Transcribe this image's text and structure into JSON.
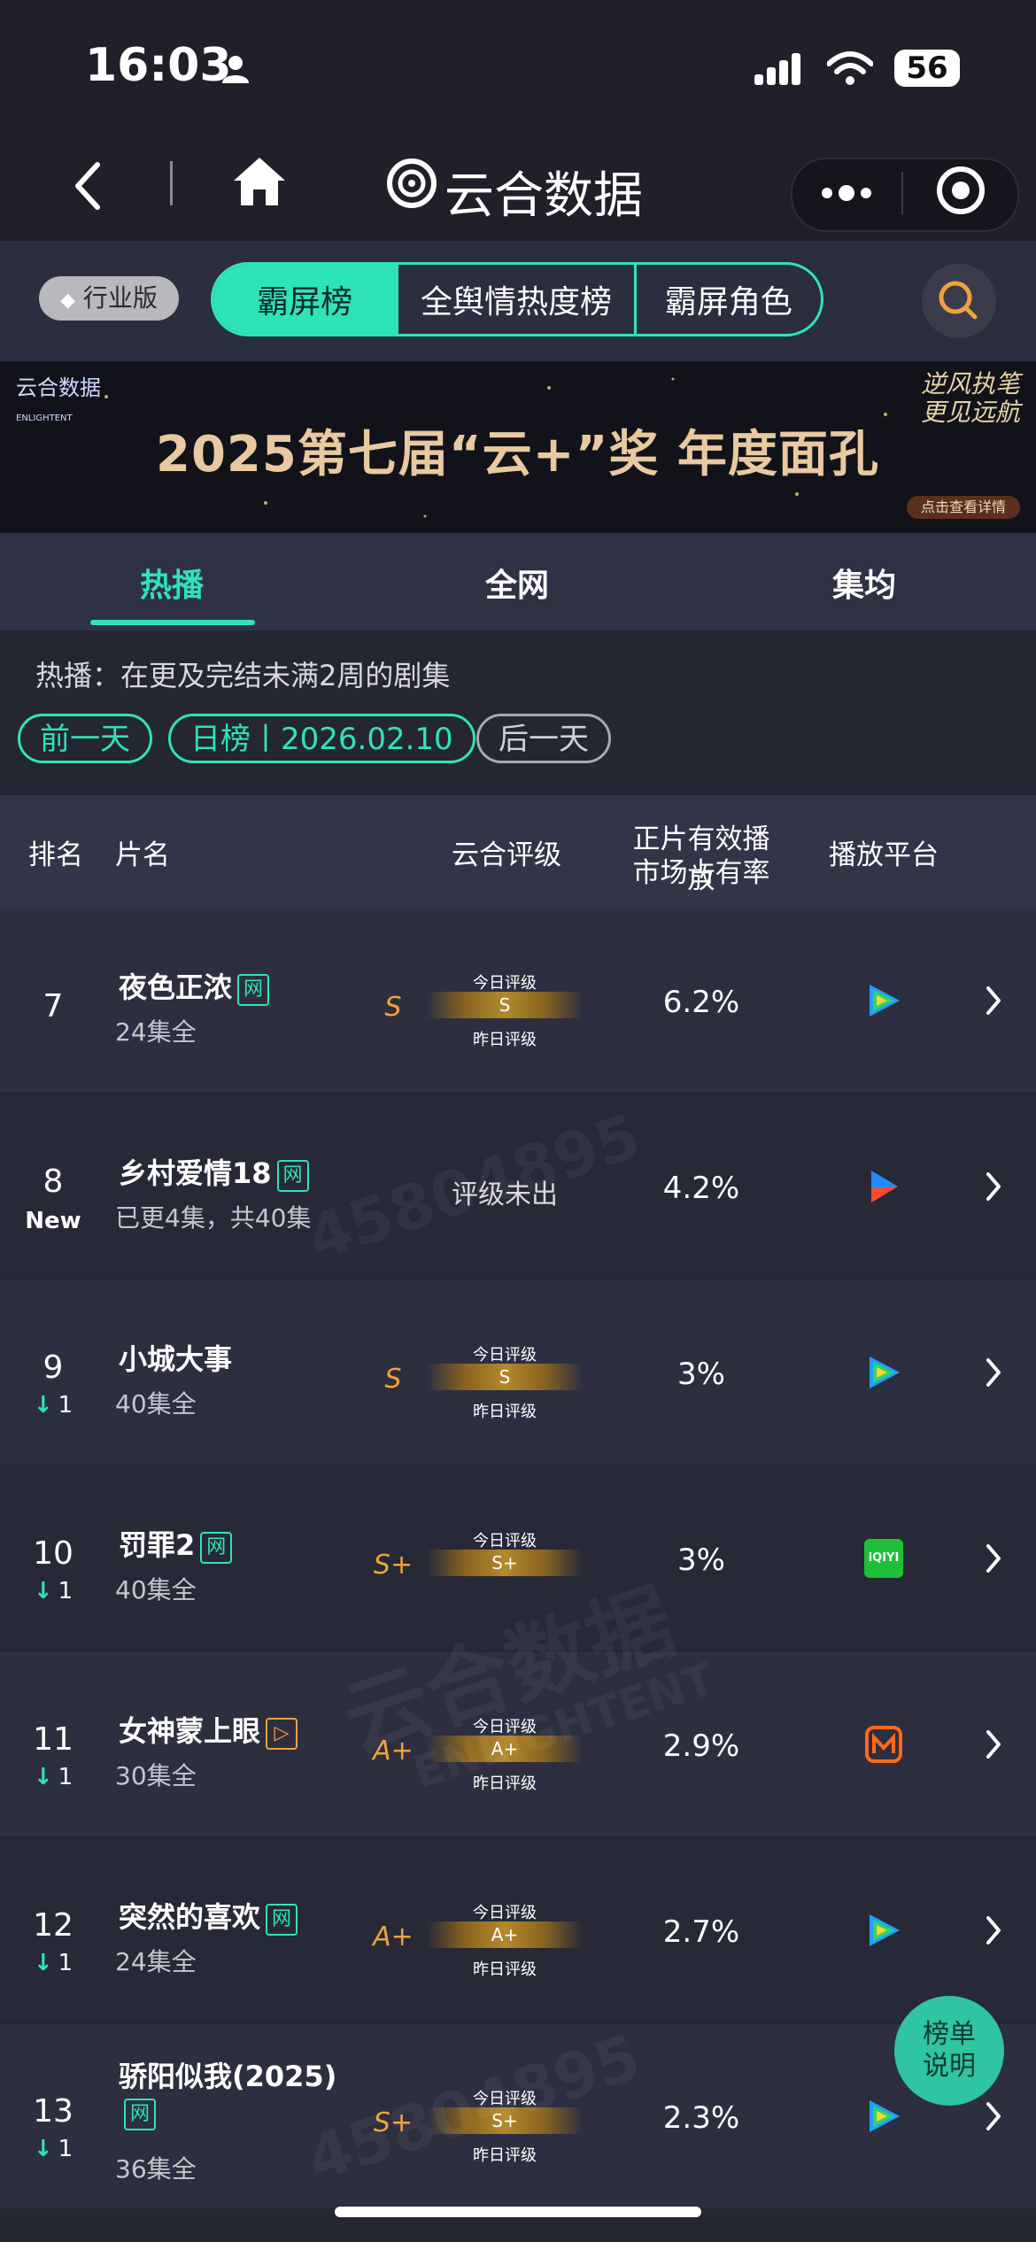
{
  "status": {
    "time": "16:03",
    "battery": "56"
  },
  "nav": {
    "title": "云合数据"
  },
  "toolbar": {
    "industry": "行业版",
    "tabs": [
      "霸屏榜",
      "全舆情热度榜",
      "霸屏角色"
    ]
  },
  "banner": {
    "logo": "云合数据",
    "logo_sub": "ENLIGHTENT",
    "text": "2025第七届“云+”奖  年度面孔",
    "slogan": "逆风执笔 更见远航",
    "cta": "点击查看详情"
  },
  "subtabs": [
    "热播",
    "全网",
    "集均"
  ],
  "description": "热播：在更及完结未满2周的剧集",
  "date_nav": {
    "prev": "前一天",
    "current": "日榜丨2026.02.10",
    "next": "后一天"
  },
  "table": {
    "headers": {
      "rank": "排名",
      "title": "片名",
      "rating": "云合评级",
      "share_line1": "正片有效播放",
      "share_line2": "市场占有率",
      "platform": "播放平台"
    },
    "today_label": "今日评级",
    "yesterday_label": "昨日评级",
    "rows": [
      {
        "rank": "7",
        "change": "",
        "title": "夜色正浓",
        "badge": "网",
        "eps": "24集全",
        "grade": "S",
        "bar": "S",
        "share": "6.2%",
        "platform": "tencent-video-icon"
      },
      {
        "rank": "8",
        "change": "New",
        "title": "乡村爱情18",
        "badge": "网",
        "eps": "已更4集，共40集",
        "grade": "",
        "no_score": "评级未出",
        "share": "4.2%",
        "platform": "youku-icon"
      },
      {
        "rank": "9",
        "change": "1",
        "title": "小城大事",
        "badge": "",
        "eps": "40集全",
        "grade": "S",
        "bar": "S",
        "share": "3%",
        "platform": "tencent-video-icon"
      },
      {
        "rank": "10",
        "change": "1",
        "title": "罚罪2",
        "badge": "网",
        "eps": "40集全",
        "grade": "S+",
        "bar": "S+",
        "share": "3%",
        "platform": "iqiyi-icon",
        "iqiyi_text": "iQIYI"
      },
      {
        "rank": "11",
        "change": "1",
        "title": "女神蒙上眼",
        "badge": "▷",
        "eps": "30集全",
        "grade": "A+",
        "bar": "A+",
        "share": "2.9%",
        "platform": "mango-tv-icon"
      },
      {
        "rank": "12",
        "change": "1",
        "title": "突然的喜欢",
        "badge": "网",
        "eps": "24集全",
        "grade": "A+",
        "bar": "A+",
        "share": "2.7%",
        "platform": "tencent-video-icon"
      },
      {
        "rank": "13",
        "change": "1",
        "title": "骄阳似我(2025)",
        "badge": "网",
        "eps": "36集全",
        "grade": "S+",
        "bar": "S+",
        "share": "2.3%",
        "platform": "tencent-video-icon"
      }
    ]
  },
  "float_button": {
    "line1": "榜单",
    "line2": "说明"
  },
  "watermark": {
    "id": "45804895",
    "brand": "云合数据",
    "brand_sub": "ENLIGHTENT"
  },
  "colors": {
    "accent": "#2fe3b8",
    "grade": "#f0a23a",
    "bg": "#242631"
  }
}
